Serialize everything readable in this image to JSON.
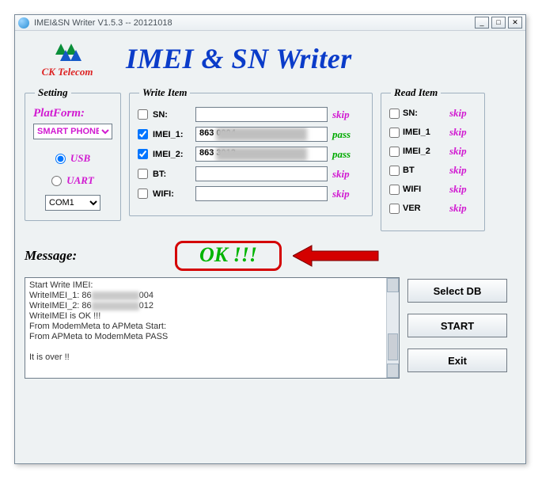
{
  "window": {
    "title": "IMEI&SN Writer V1.5.3 -- 20121018"
  },
  "header": {
    "brand": "CK Telecom",
    "app_title": "IMEI & SN Writer"
  },
  "setting": {
    "legend": "Setting",
    "platform_label": "PlatForm:",
    "platform_value": "SMART PHONE",
    "usb_label": "USB",
    "uart_label": "UART",
    "connection": "USB",
    "com_value": "COM1"
  },
  "write": {
    "legend": "Write Item",
    "items": [
      {
        "checked": false,
        "label": "SN:",
        "value": "",
        "status": "skip",
        "cls": "skip",
        "blurred": false
      },
      {
        "checked": true,
        "label": "IMEI_1:",
        "value": "863          0004",
        "status": "pass",
        "cls": "pass",
        "blurred": true
      },
      {
        "checked": true,
        "label": "IMEI_2:",
        "value": "863          3012",
        "status": "pass",
        "cls": "pass",
        "blurred": true
      },
      {
        "checked": false,
        "label": "BT:",
        "value": "",
        "status": "skip",
        "cls": "skip",
        "blurred": false
      },
      {
        "checked": false,
        "label": "WIFI:",
        "value": "",
        "status": "skip",
        "cls": "skip",
        "blurred": false
      }
    ]
  },
  "read": {
    "legend": "Read Item",
    "items": [
      {
        "label": "SN:",
        "status": "skip"
      },
      {
        "label": "IMEI_1",
        "status": "skip"
      },
      {
        "label": "IMEI_2",
        "status": "skip"
      },
      {
        "label": "BT",
        "status": "skip"
      },
      {
        "label": "WIFI",
        "status": "skip"
      },
      {
        "label": "VER",
        "status": "skip"
      }
    ]
  },
  "message": {
    "label": "Message:",
    "ok_text": "OK !!!",
    "log_lines": [
      "Start Write IMEI:",
      "  WriteIMEI_1: 86▒▒▒▒▒▒004",
      "  WriteIMEI_2: 86▒▒▒▒▒▒012",
      "  WriteIMEI is OK !!!",
      "From ModemMeta to APMeta Start:",
      "From APMeta to ModemMeta PASS",
      "",
      "It is over !!"
    ]
  },
  "buttons": {
    "select_db": "Select DB",
    "start": "START",
    "exit": "Exit"
  }
}
